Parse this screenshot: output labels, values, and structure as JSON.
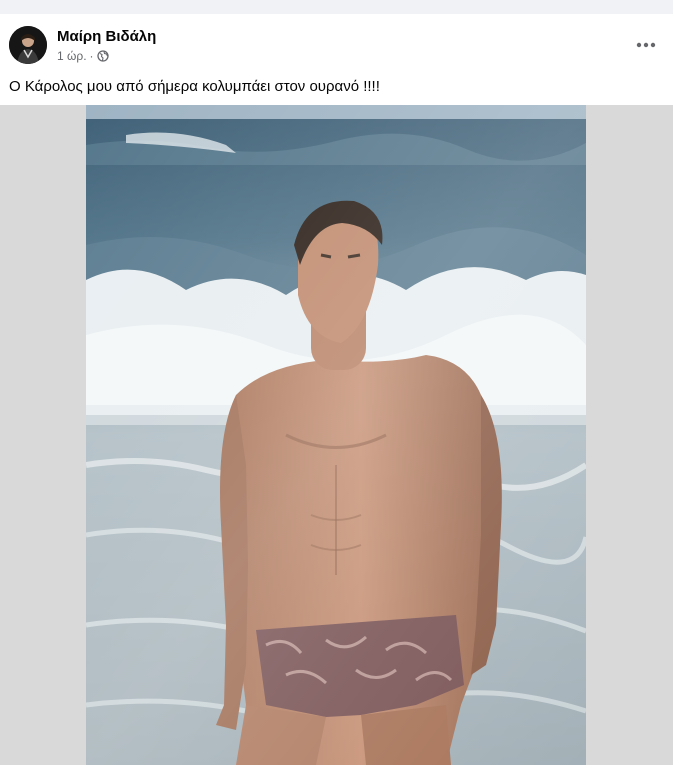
{
  "post": {
    "author": "Μαίρη Βιδάλη",
    "time": "1 ώρ.",
    "separator": "·",
    "privacy_icon": "globe-icon",
    "more_icon": "more-options-icon",
    "caption": "Ο Κάρολος μου από σήμερα κολυμπάει στον ουρανό !!!!"
  },
  "colors": {
    "author_text": "#050505",
    "meta_text": "#65676b",
    "page_background": "#f0f2f5",
    "media_background": "#d9d9d9"
  }
}
